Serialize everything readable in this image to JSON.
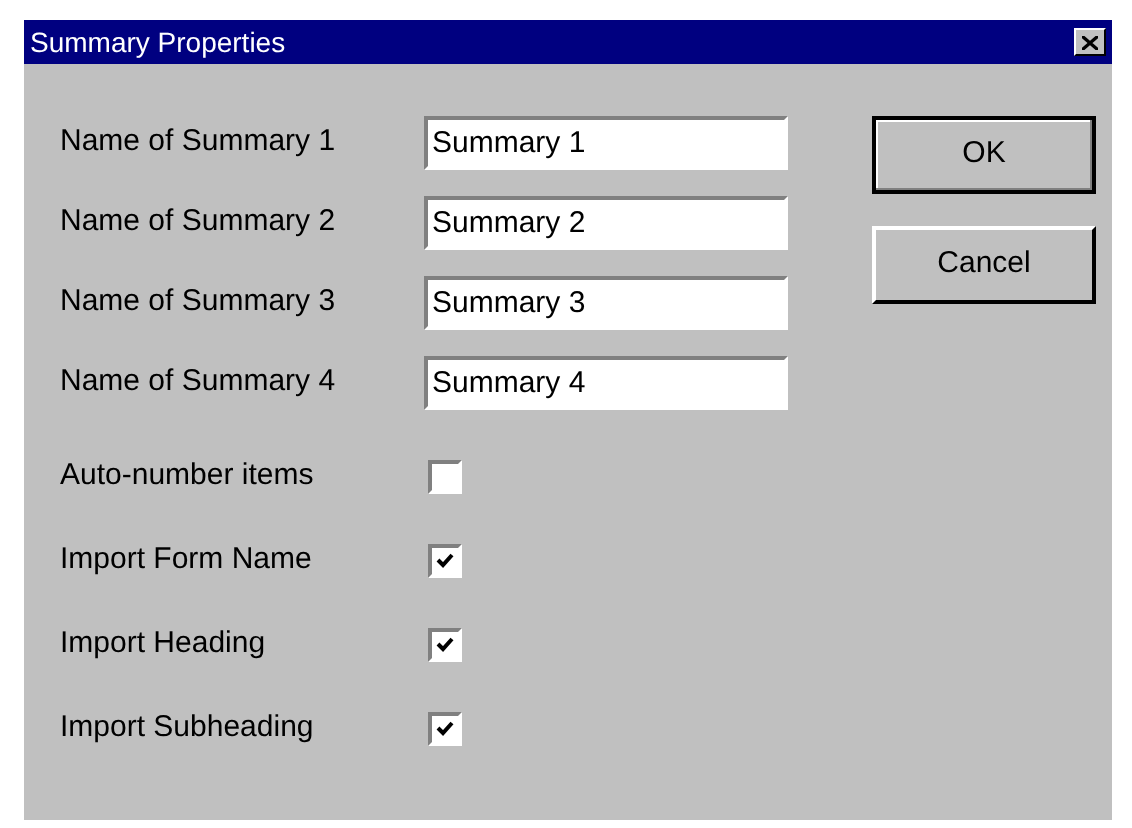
{
  "window": {
    "title": "Summary Properties"
  },
  "fields": [
    {
      "label": "Name of Summary 1",
      "value": "Summary 1"
    },
    {
      "label": "Name of Summary 2",
      "value": "Summary 2"
    },
    {
      "label": "Name of Summary 3",
      "value": "Summary 3"
    },
    {
      "label": "Name of Summary 4",
      "value": "Summary 4"
    }
  ],
  "checkboxes": [
    {
      "label": "Auto-number items",
      "checked": false
    },
    {
      "label": "Import Form Name",
      "checked": true
    },
    {
      "label": "Import Heading",
      "checked": true
    },
    {
      "label": "Import Subheading",
      "checked": true
    }
  ],
  "buttons": [
    "OK",
    "Cancel"
  ]
}
